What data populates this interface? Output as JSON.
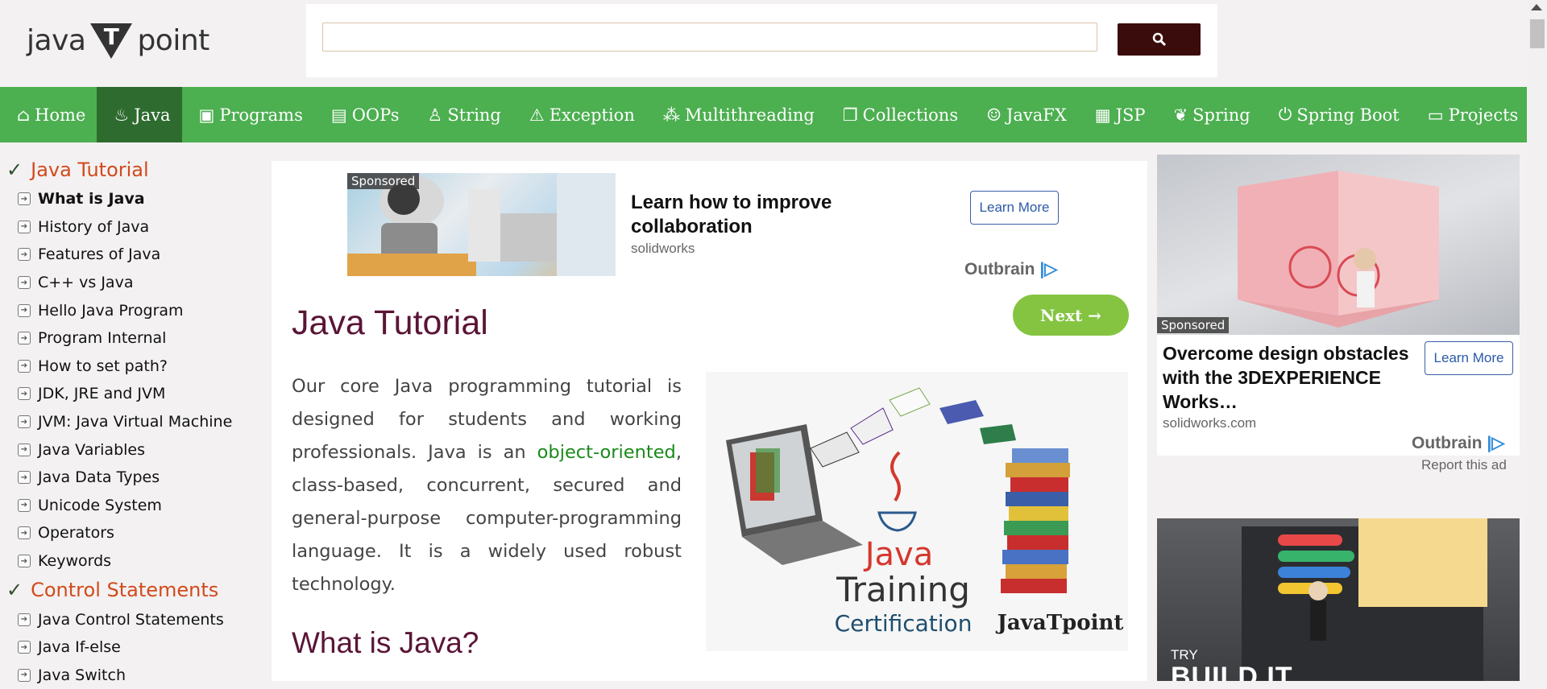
{
  "logo": {
    "left": "java",
    "mark": "T",
    "right": "point"
  },
  "search": {
    "placeholder": "",
    "value": ""
  },
  "nav": [
    {
      "label": "Home",
      "icon": "home-icon"
    },
    {
      "label": "Java",
      "icon": "java-cup-icon",
      "active": true
    },
    {
      "label": "Programs",
      "icon": "monitor-icon"
    },
    {
      "label": "OOPs",
      "icon": "chart-window-icon"
    },
    {
      "label": "String",
      "icon": "string-flame-icon"
    },
    {
      "label": "Exception",
      "icon": "warning-icon"
    },
    {
      "label": "Multithreading",
      "icon": "threads-icon"
    },
    {
      "label": "Collections",
      "icon": "stack-icon"
    },
    {
      "label": "JavaFX",
      "icon": "robot-icon"
    },
    {
      "label": "JSP",
      "icon": "jsp-file-icon"
    },
    {
      "label": "Spring",
      "icon": "leaf-icon"
    },
    {
      "label": "Spring Boot",
      "icon": "power-icon"
    },
    {
      "label": "Projects",
      "icon": "folder-icon"
    }
  ],
  "sidebar": {
    "sections": [
      {
        "title": "Java Tutorial",
        "items": [
          "What is Java",
          "History of Java",
          "Features of Java",
          "C++ vs Java",
          "Hello Java Program",
          "Program Internal",
          "How to set path?",
          "JDK, JRE and JVM",
          "JVM: Java Virtual Machine",
          "Java Variables",
          "Java Data Types",
          "Unicode System",
          "Operators",
          "Keywords"
        ]
      },
      {
        "title": "Control Statements",
        "items": [
          "Java Control Statements",
          "Java If-else",
          "Java Switch"
        ]
      }
    ]
  },
  "ad_top": {
    "sponsored": "Sponsored",
    "title": "Learn how to improve collaboration",
    "source": "solidworks",
    "cta": "Learn More",
    "network": "Outbrain"
  },
  "main": {
    "title": "Java Tutorial",
    "next": "Next →",
    "intro_before": "Our core Java programming tutorial is designed for students and working professionals. Java is an ",
    "intro_link": "object-oriented",
    "intro_after": ", class-based, concurrent, secured and general-purpose computer-programming language. It is a widely used robust technology.",
    "hero": {
      "java": "Java",
      "training": "Training",
      "cert": "Certification",
      "brand": "JavaTpoint"
    },
    "h2": "What is Java?"
  },
  "ad_right": {
    "sponsored": "Sponsored",
    "title": "Overcome design obstacles with the 3DEXPERIENCE Works…",
    "source": "solidworks.com",
    "cta": "Learn More",
    "network": "Outbrain",
    "report": "Report this ad"
  },
  "ad_bottom": {
    "try": "TRY",
    "build": "BUILD IT"
  },
  "colors": {
    "nav": "#4caf50",
    "nav_active": "#2e6b2f",
    "title": "#5a1536",
    "sidebar_head": "#d24a1d",
    "next": "#84c441",
    "search_btn": "#3b0c0c"
  }
}
